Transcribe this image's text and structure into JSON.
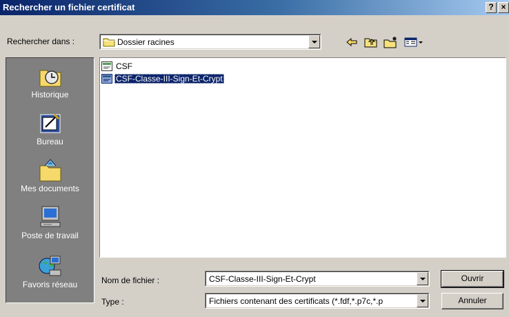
{
  "window": {
    "title": "Rechercher un fichier certificat",
    "help_label": "?",
    "close_label": "×"
  },
  "look_in": {
    "label": "Rechercher dans :",
    "value": "Dossier racines"
  },
  "toolbar": {
    "back_icon": "back-arrow-icon",
    "up_icon": "up-folder-icon",
    "new_folder_icon": "new-folder-icon",
    "view_icon": "view-menu-icon"
  },
  "places": [
    {
      "label": "Historique",
      "icon": "history-icon"
    },
    {
      "label": "Bureau",
      "icon": "desktop-icon"
    },
    {
      "label": "Mes documents",
      "icon": "my-documents-icon"
    },
    {
      "label": "Poste de travail",
      "icon": "my-computer-icon"
    },
    {
      "label": "Favoris réseau",
      "icon": "network-places-icon"
    }
  ],
  "files": [
    {
      "name": "CSF",
      "selected": false
    },
    {
      "name": "CSF-Classe-III-Sign-Et-Crypt",
      "selected": true
    }
  ],
  "filename": {
    "label": "Nom de fichier :",
    "value": "CSF-Classe-III-Sign-Et-Crypt"
  },
  "filetype": {
    "label": "Type :",
    "value": "Fichiers contenant des certificats (*.fdf,*.p7c,*.p"
  },
  "buttons": {
    "open": "Ouvrir",
    "cancel": "Annuler"
  },
  "colors": {
    "title_bar": "#0a246a",
    "selection": "#0a246a",
    "dialog_bg": "#d4d0c8",
    "places_bg": "#808080"
  }
}
